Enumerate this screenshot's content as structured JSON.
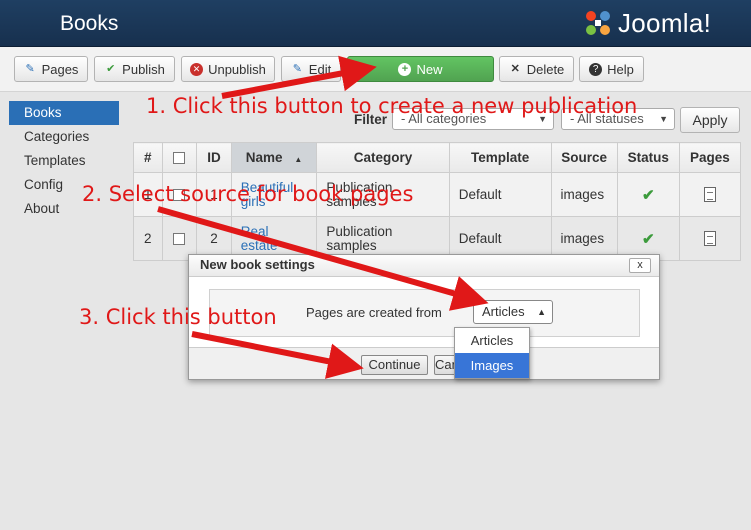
{
  "header": {
    "title": "Books",
    "logo_text": "Joomla!"
  },
  "toolbar": {
    "pages_label": "Pages",
    "publish_label": "Publish",
    "unpublish_label": "Unpublish",
    "edit_label": "Edit",
    "new_label": "New",
    "delete_label": "Delete",
    "help_label": "Help"
  },
  "sidebar": {
    "items": [
      {
        "label": "Books",
        "active": true
      },
      {
        "label": "Categories"
      },
      {
        "label": "Templates"
      },
      {
        "label": "Config"
      },
      {
        "label": "About"
      }
    ]
  },
  "filter": {
    "label": "Filter",
    "category_value": "- All categories",
    "status_value": "- All statuses",
    "apply_label": "Apply"
  },
  "table": {
    "headers": [
      "#",
      "",
      "ID",
      "Name",
      "Category",
      "Template",
      "Source",
      "Status",
      "Pages"
    ],
    "rows": [
      {
        "num": "1",
        "id": "1",
        "name": "Beautiful girls",
        "category": "Publication samples",
        "template": "Default",
        "source": "images",
        "status": "published"
      },
      {
        "num": "2",
        "id": "2",
        "name": "Real estate",
        "category": "Publication samples",
        "template": "Default",
        "source": "images",
        "status": "published"
      }
    ]
  },
  "dialog": {
    "title": "New book settings",
    "close_label": "x",
    "field_label": "Pages are created from",
    "selected_value": "Articles",
    "options": [
      "Articles",
      "Images"
    ],
    "highlighted_option": "Images",
    "continue_label": "Continue",
    "cancel_label": "Cancel"
  },
  "annotations": {
    "step1": "1. Click this button to create a new publication",
    "step2": "2. Select source for book pages",
    "step3": "3. Click this button"
  },
  "colors": {
    "header_bg": "#1a3554",
    "accent_blue": "#2a6fb6",
    "new_button_green": "#51a351",
    "annotation_red": "#e01818",
    "status_green": "#3c9b3c"
  }
}
